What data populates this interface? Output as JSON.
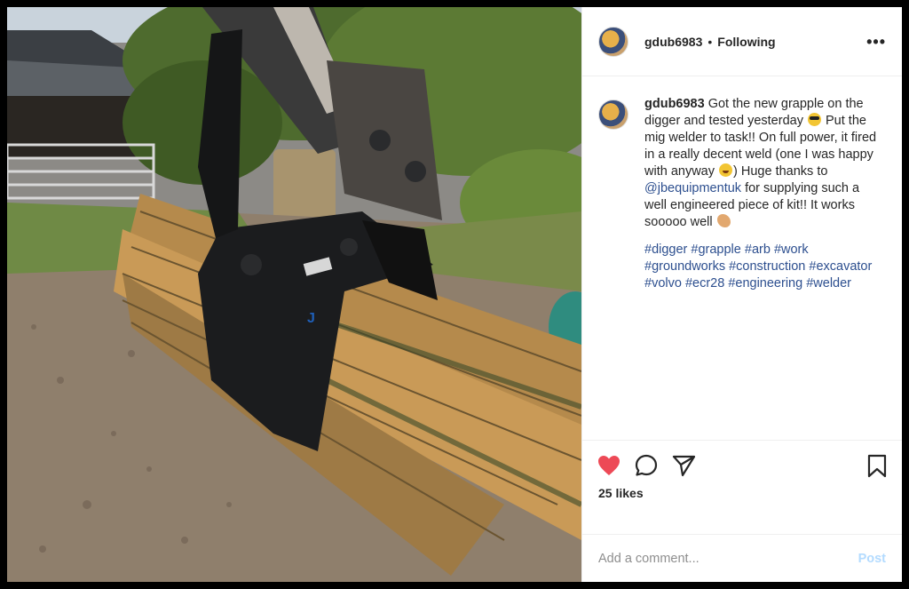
{
  "post": {
    "username": "gdub6983",
    "separator": "•",
    "follow_status": "Following",
    "more_icon": "more-options-icon",
    "photo_alt": "Grapple attachment on digger holding timber",
    "caption": {
      "username": "gdub6983",
      "part1": "Got the new grapple on the digger and tested yesterday",
      "part2": "Put the mig welder to task!! On full power, it fired in a really decent weld (one I was happy with anyway",
      "part3": ") Huge thanks to",
      "mention": "@jbequipmentuk",
      "part4": "for supplying such a well engineered piece of kit!! It works sooooo well",
      "emojis": [
        "sunglasses-emoji",
        "grinning-emoji",
        "flexed-biceps-emoji"
      ]
    },
    "hashtags": [
      "#digger",
      "#grapple",
      "#arb",
      "#work",
      "#groundworks",
      "#construction",
      "#excavator",
      "#volvo",
      "#ecr28",
      "#engineering",
      "#welder"
    ],
    "actions": {
      "like_icon": "heart-icon",
      "comment_icon": "comment-icon",
      "share_icon": "share-icon",
      "save_icon": "bookmark-icon",
      "liked_color": "#ed4956"
    },
    "likes_text": "25 likes",
    "comment": {
      "placeholder": "Add a comment...",
      "post_label": "Post",
      "post_color": "#b3dbff"
    }
  }
}
